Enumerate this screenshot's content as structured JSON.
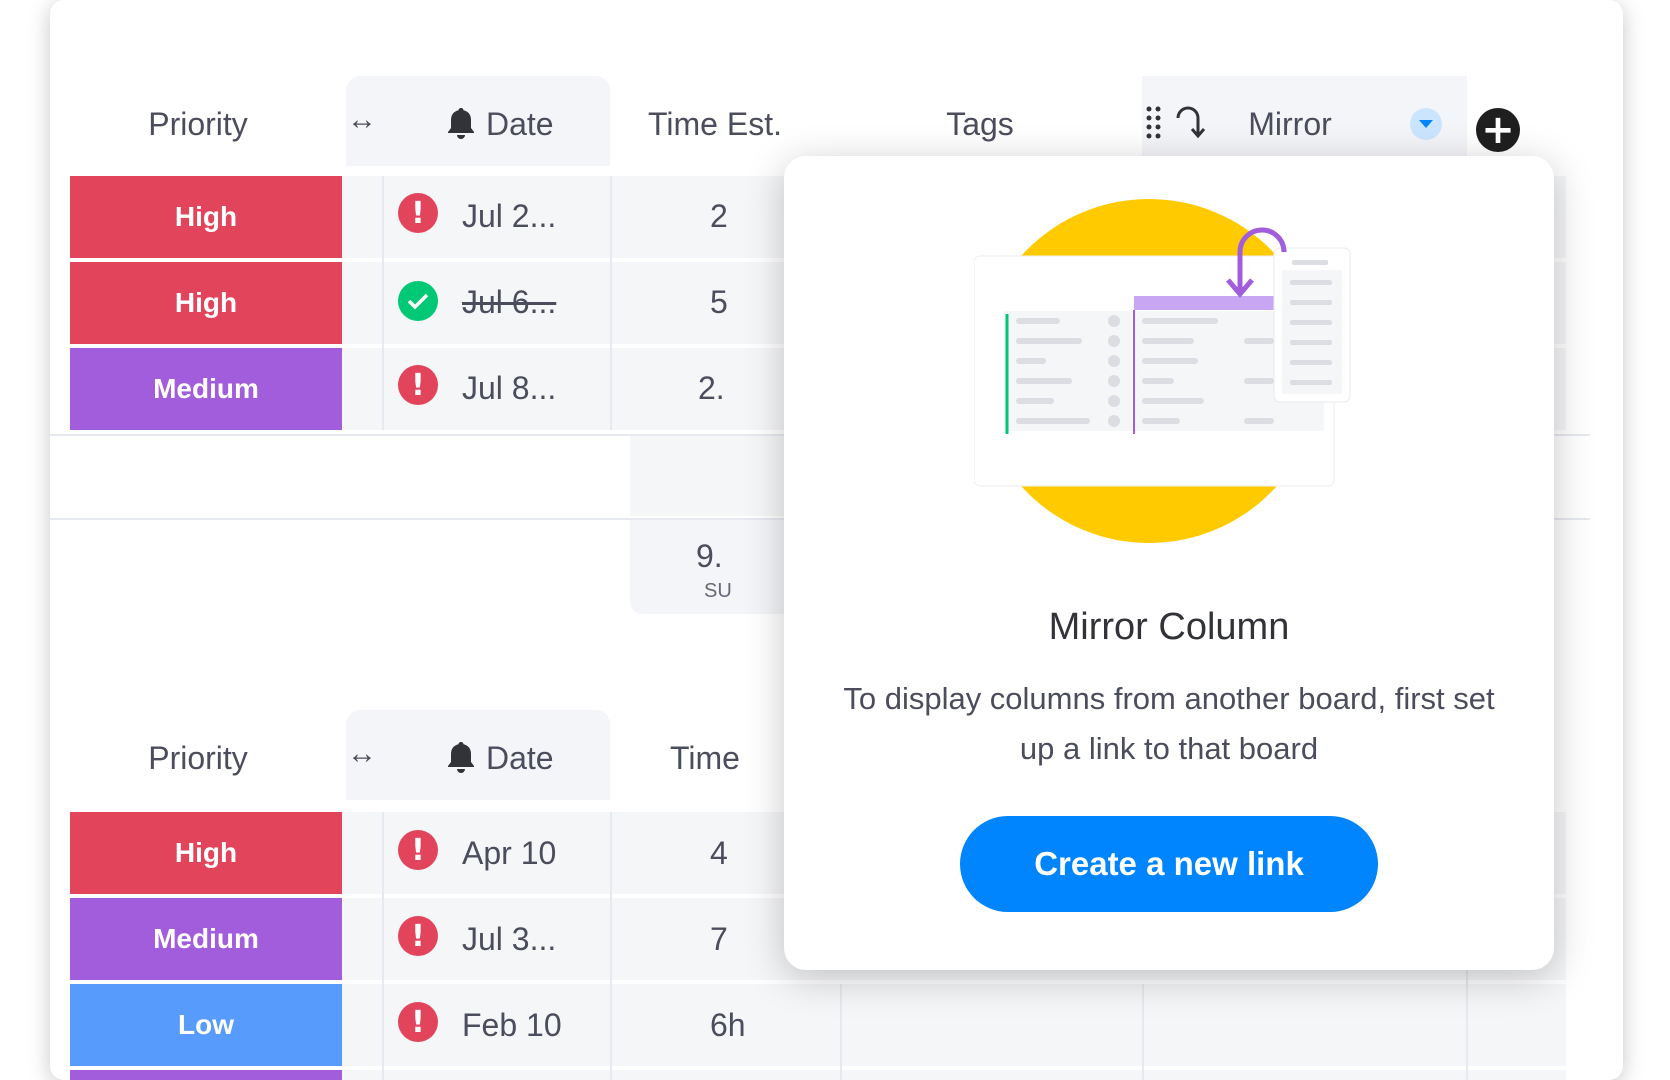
{
  "board1": {
    "headers": {
      "priority": "Priority",
      "resize": "↔",
      "date": "Date",
      "time_est": "Time Est.",
      "tags": "Tags",
      "mirror": "Mirror"
    },
    "rows": [
      {
        "priority": "High",
        "priority_color": "#e2445c",
        "date": "Jul 2...",
        "date_status": "overdue",
        "time": "2"
      },
      {
        "priority": "High",
        "priority_color": "#e2445c",
        "date": "Jul 6...",
        "date_status": "done",
        "time": "5"
      },
      {
        "priority": "Medium",
        "priority_color": "#a25ddc",
        "date": "Jul 8...",
        "date_status": "overdue",
        "time": "2."
      }
    ],
    "summary_value": "9.",
    "summary_label": "SU"
  },
  "board2": {
    "headers": {
      "priority": "Priority",
      "resize": "↔",
      "date": "Date",
      "time_est": "Time"
    },
    "rows": [
      {
        "priority": "High",
        "priority_color": "#e2445c",
        "date": "Apr 10",
        "date_status": "overdue",
        "time": "4"
      },
      {
        "priority": "Medium",
        "priority_color": "#a25ddc",
        "date": "Jul 3...",
        "date_status": "overdue",
        "time": "7"
      },
      {
        "priority": "Low",
        "priority_color": "#579bfc",
        "date": "Feb 10",
        "date_status": "overdue",
        "time": "6h"
      }
    ]
  },
  "popup": {
    "title": "Mirror Column",
    "description": "To display columns from another board, first set up a link to that board",
    "button": "Create a new link"
  },
  "icons": {
    "add": "plus-circle-icon",
    "bell": "bell-icon",
    "alert": "exclamation-icon",
    "check": "check-icon",
    "drag": "drag-handle-icon",
    "mirror": "mirror-arrow-icon",
    "dropdown": "caret-down-icon"
  },
  "colors": {
    "high": "#e2445c",
    "medium": "#a25ddc",
    "low": "#579bfc",
    "done": "#00c875",
    "primary": "#0085ff",
    "illustration_yellow": "#ffcb00"
  }
}
